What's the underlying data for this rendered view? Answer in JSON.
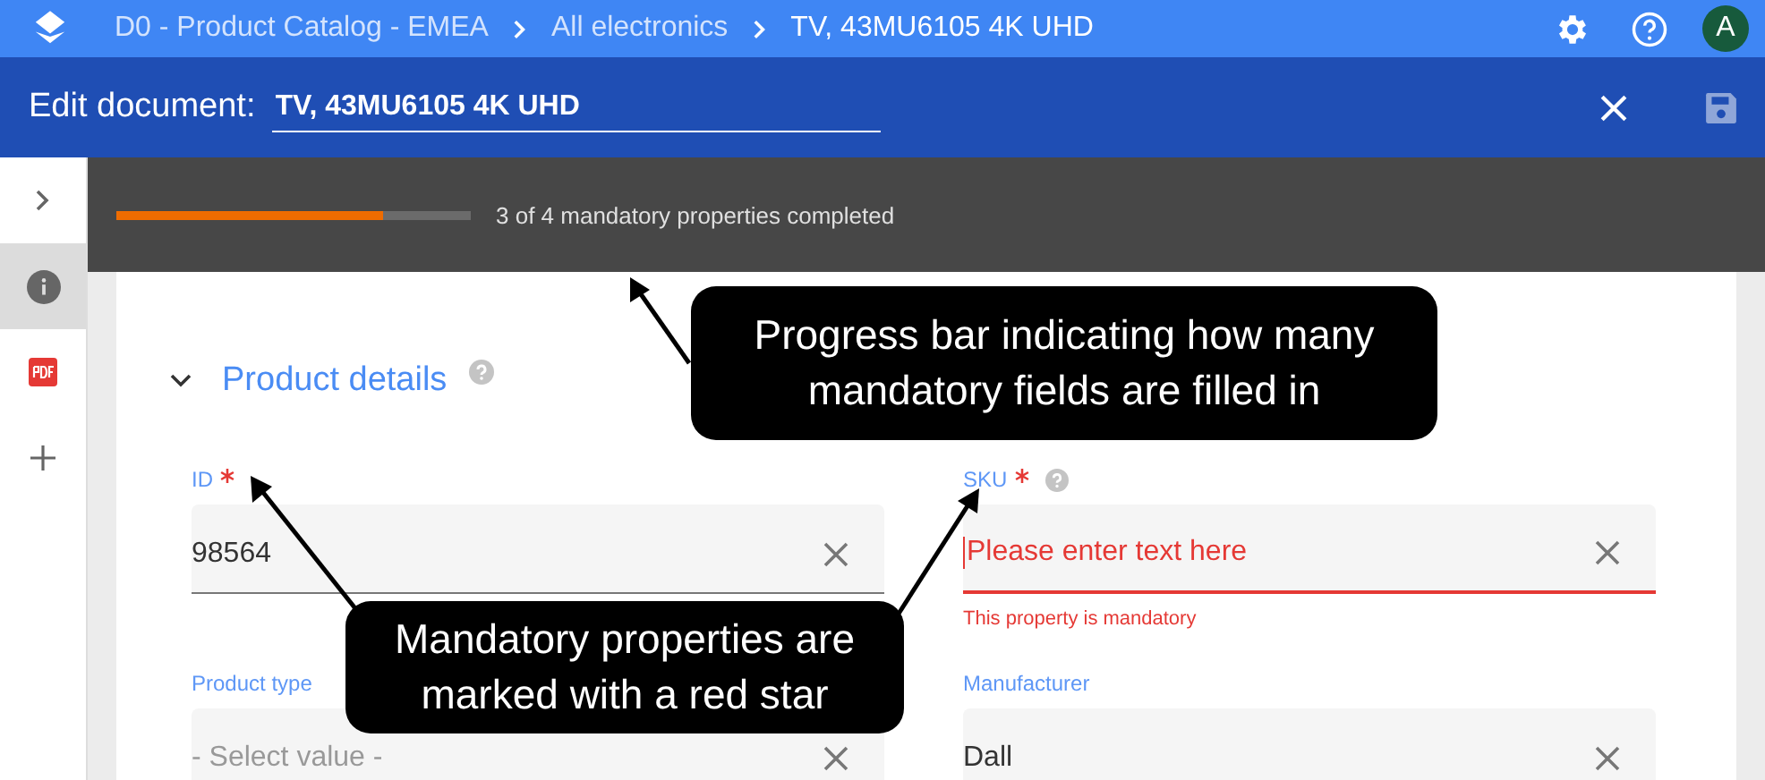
{
  "breadcrumbs": [
    {
      "label": "D0 - Product Catalog - EMEA",
      "current": false
    },
    {
      "label": "All electronics",
      "current": false
    },
    {
      "label": "TV, 43MU6105 4K UHD",
      "current": true
    }
  ],
  "avatar": "A",
  "edit_bar": {
    "label": "Edit document:",
    "title": "TV, 43MU6105 4K UHD"
  },
  "sidebar": {
    "items": [
      {
        "kind": "expand",
        "selected": false
      },
      {
        "kind": "info",
        "selected": true
      },
      {
        "kind": "pdf",
        "selected": false
      },
      {
        "kind": "add",
        "selected": false
      }
    ]
  },
  "progress": {
    "level": 0.75,
    "text": "3 of 4 mandatory properties completed"
  },
  "section": {
    "title": "Product details",
    "expanded": true,
    "help": true
  },
  "fields": [
    {
      "kind": "text",
      "label": "ID",
      "required": true,
      "help": false,
      "value": "98564"
    },
    {
      "kind": "text",
      "label": "SKU",
      "required": true,
      "help": true,
      "placeholder": "Please enter text here",
      "error": "This property is mandatory"
    },
    {
      "kind": "select",
      "label": "Product type",
      "required": false,
      "help": false,
      "placeholder": "- Select value -"
    },
    {
      "kind": "text",
      "label": "Manufacturer",
      "required": false,
      "help": false,
      "value": "Dall"
    }
  ],
  "callouts": [
    {
      "text": "Progress bar indicating how many mandatory fields are filled in"
    },
    {
      "text": "Mandatory properties are marked with a red star"
    }
  ]
}
